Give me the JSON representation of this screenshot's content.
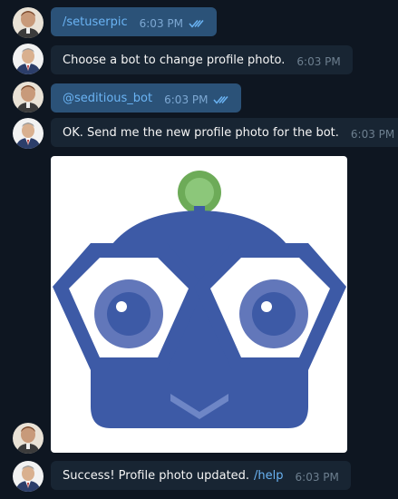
{
  "messages": [
    {
      "direction": "out",
      "text": "/setuserpic",
      "time": "6:03 PM"
    },
    {
      "direction": "in",
      "text": "Choose a bot to change profile photo.",
      "time": "6:03 PM"
    },
    {
      "direction": "out",
      "text": "@seditious_bot",
      "time": "6:03 PM"
    },
    {
      "direction": "in",
      "text": "OK. Send me the new profile photo for the bot.",
      "time": "6:03 PM"
    },
    {
      "direction": "out",
      "type": "photo",
      "icon": "robot-face-image"
    },
    {
      "direction": "in",
      "text": "Success! Profile photo updated.",
      "link": "/help",
      "time": "6:03 PM"
    }
  ],
  "colors": {
    "background": "#0e1621",
    "outgoing_bubble": "#2b5278",
    "incoming_bubble": "#182533",
    "link": "#6ab3f3",
    "robot_blue": "#3d5aa6",
    "robot_green": "#6dab58"
  }
}
